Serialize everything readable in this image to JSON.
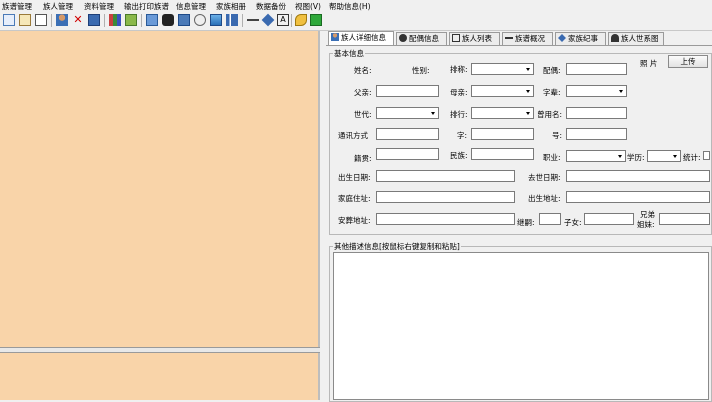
{
  "menu": [
    "族谱管理",
    "族人管理",
    "资料管理",
    "输出打印族谱",
    "信息管理",
    "家族相册",
    "数据备份",
    "视图(V)",
    "帮助信息(H)"
  ],
  "toolbar_icons": [
    "new-icon",
    "open-book-icon",
    "book-icon",
    "person-icon",
    "delete-icon",
    "save-icon",
    "books-icon",
    "edit-icon",
    "tree-icon",
    "binoculars-icon",
    "print-icon",
    "photo-icon",
    "settings-icon",
    "chart-icon",
    "link-icon",
    "diamond-icon",
    "font-icon",
    "key-icon",
    "exit-icon"
  ],
  "tabs": [
    {
      "label": "族人详细信息",
      "icon": "person-icon",
      "active": true
    },
    {
      "label": "配偶信息",
      "icon": "spouse-icon",
      "active": false
    },
    {
      "label": "族人列表",
      "icon": "list-icon",
      "active": false
    },
    {
      "label": "族谱概况",
      "icon": "overview-icon",
      "active": false
    },
    {
      "label": "家族纪事",
      "icon": "chronicle-icon",
      "active": false
    },
    {
      "label": "族人世系图",
      "icon": "lineage-icon",
      "active": false
    }
  ],
  "basic": {
    "legend": "基本信息",
    "name": "姓名:",
    "gender": "性别:",
    "nickname": "排称:",
    "spouse": "配偶:",
    "photo": "照 片",
    "upload": "上传",
    "father": "父亲:",
    "mother": "母亲:",
    "courtesy": "字辈:",
    "generation": "世代:",
    "rank": "排行:",
    "used_name": "曾用名:",
    "contact": "通讯方式",
    "zi": "字:",
    "hao": "号:",
    "native": "籍贯:",
    "ethnic": "民族:",
    "job": "职业:",
    "edu": "学历:",
    "stat": "统计:",
    "birth": "出生日期:",
    "death": "去世日期:",
    "address": "家庭住址:",
    "birthplace": "出生地址:",
    "burial": "安葬地址:",
    "score": "继嗣:",
    "children": "子女:",
    "siblings1": "兄弟",
    "siblings2": "姐妹:"
  },
  "other": {
    "legend": "其他描述信息[按鼠标右键复制和粘贴]"
  }
}
